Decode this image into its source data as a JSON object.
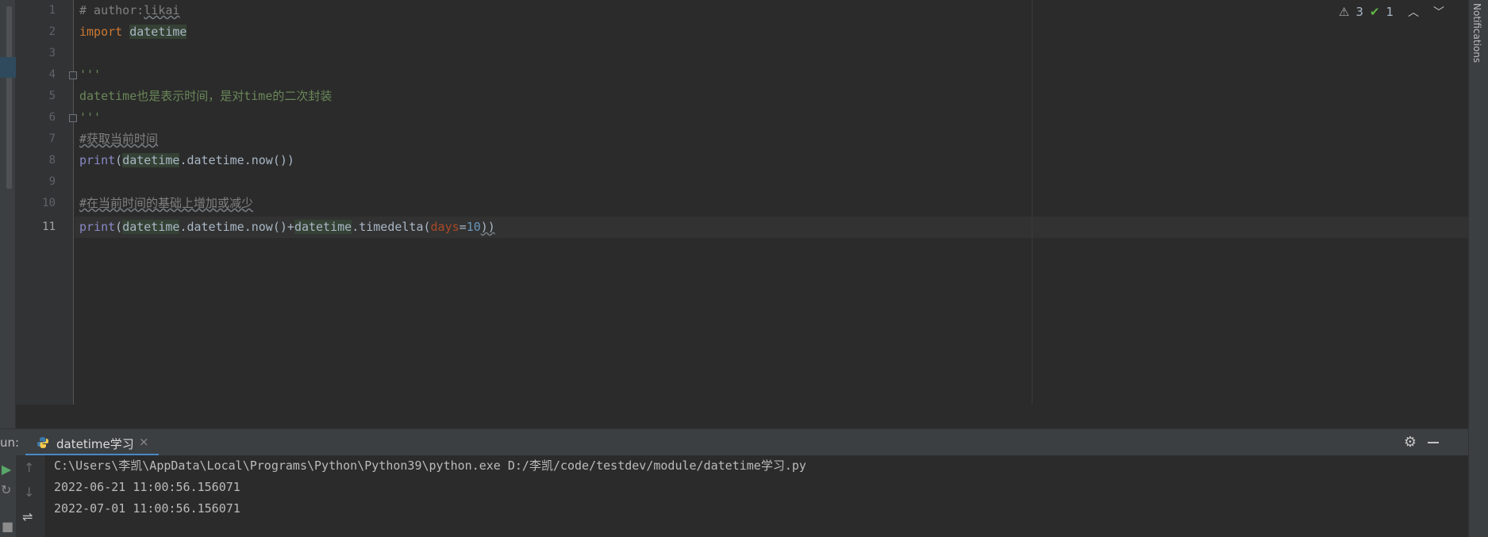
{
  "editor": {
    "line_numbers": [
      "1",
      "2",
      "3",
      "4",
      "5",
      "6",
      "7",
      "8",
      "9",
      "10",
      "11"
    ],
    "lines": {
      "l1_comment": "# author:",
      "l1_name": "likai",
      "l2_kw": "import",
      "l2_mod": "datetime",
      "l4": "'''",
      "l5": "datetime也是表示时间，是对time的二次封装",
      "l6": "'''",
      "l7": "#获取当前时间",
      "l8_print": "print",
      "l8_open": "(",
      "l8_mod": "datetime",
      "l8_rest": ".datetime.now())",
      "l10": "#在当前时间的基础上增加或减少",
      "l11_print": "print",
      "l11_open": "(",
      "l11_mod1": "datetime",
      "l11_mid": ".datetime.now()+",
      "l11_mod2": "datetime",
      "l11_call": ".timedelta(",
      "l11_kwarg": "days",
      "l11_eq": "=",
      "l11_num": "10",
      "l11_close": "))"
    },
    "inspections": {
      "warnings": "3",
      "weak_warnings": "1"
    }
  },
  "notifications_label": "Notifications",
  "run_panel": {
    "label": "un:",
    "tab_label": "datetime学习",
    "console_lines": [
      "C:\\Users\\李凯\\AppData\\Local\\Programs\\Python\\Python39\\python.exe D:/李凯/code/testdev/module/datetime学习.py",
      "2022-06-21 11:00:56.156071",
      "2022-07-01 11:00:56.156071"
    ]
  },
  "colors": {
    "background": "#2b2b2b",
    "keyword": "#cc7832",
    "string": "#6a8759",
    "comment": "#808080",
    "builtin": "#8888c6",
    "number": "#6897bb",
    "tab_underline": "#4a88c7"
  },
  "icons": [
    "warning-icon",
    "check-icon",
    "arrow-up-icon",
    "arrow-down-icon",
    "python-file-icon",
    "close-icon",
    "gear-icon",
    "minimize-icon",
    "run-icon",
    "rerun-icon",
    "scroll-up-icon",
    "scroll-down-icon",
    "soft-wrap-icon"
  ]
}
